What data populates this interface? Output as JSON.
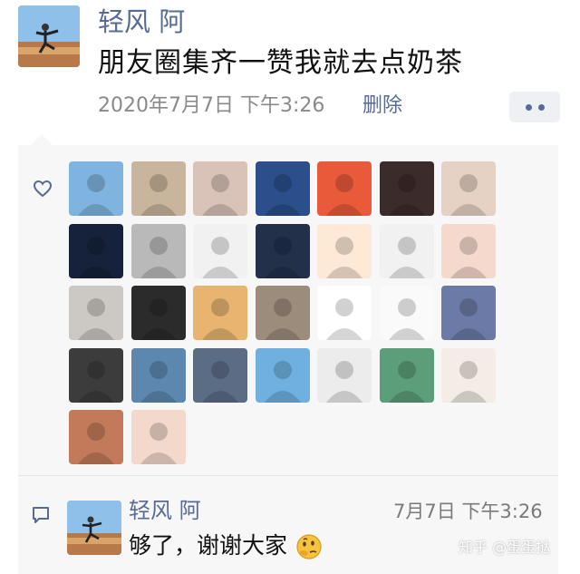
{
  "post": {
    "author": "轻风 阿",
    "text": "朋友圈集齐一赞我就去点奶茶",
    "time": "2020年7月7日 下午3:26",
    "delete_label": "删除"
  },
  "likes": {
    "count": 30,
    "avatar_colors": [
      [
        "#7fb4e0",
        "#c9b49c",
        "#d9c2b8",
        "#2a4f8a",
        "#e85a3a",
        "#3b2b2a",
        "#e6d2c4"
      ],
      [
        "#16223b",
        "#b9b9b9",
        "#f1f1f1",
        "#22304a",
        "#fde9d6",
        "#f1f1f1",
        "#f6d9cd"
      ],
      [
        "#ccc8c4",
        "#2b2b2b",
        "#e8b470",
        "#9c8c7c",
        "#ffffff",
        "#fafafa",
        "#6b7aa6"
      ],
      [
        "#3c3c3c",
        "#5c88b0",
        "#5b6d85",
        "#6fb0e0",
        "#ececec",
        "#5c9e79",
        "#f4ece6"
      ],
      [
        "#c27a5a",
        "#f3d8cc"
      ]
    ]
  },
  "comment": {
    "author": "轻风 阿",
    "time": "7月7日 下午3:26",
    "text": "够了，谢谢大家",
    "emoji": "thinking-face-emoji"
  },
  "watermark": "知乎 @蛋蛋挞",
  "colors": {
    "link": "#576b95",
    "panel_bg": "#f7f7f7",
    "text_primary": "#111111",
    "text_secondary": "#8a8a8a"
  }
}
